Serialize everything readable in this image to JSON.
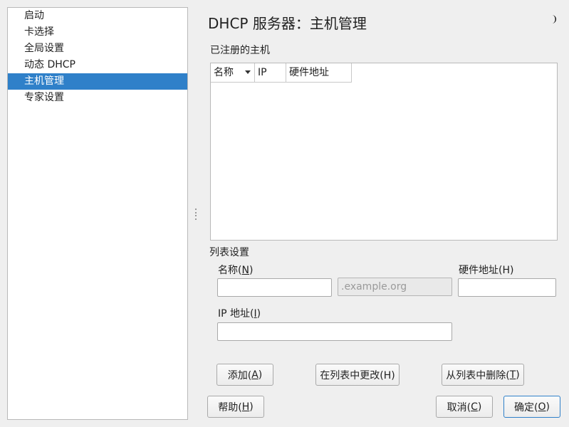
{
  "sidebar": {
    "items": [
      {
        "label": "启动"
      },
      {
        "label": "卡选择"
      },
      {
        "label": "全局设置"
      },
      {
        "label": "动态 DHCP"
      },
      {
        "label": "主机管理"
      },
      {
        "label": "专家设置"
      }
    ],
    "selected_index": 4
  },
  "header": {
    "title": "DHCP 服务器：主机管理",
    "theme_icon": "moon-icon"
  },
  "registered_hosts": {
    "label": "已注册的主机",
    "columns": [
      "名称",
      "IP",
      "硬件地址"
    ],
    "rows": []
  },
  "list_settings": {
    "label": "列表设置",
    "name_label": "名称(",
    "name_key": "N",
    "hw_label": "硬件地址(H)",
    "domain_placeholder": ".example.org",
    "ip_label": "IP 地址(",
    "ip_key": "I"
  },
  "actions": {
    "add": {
      "text": "添加(",
      "key": "A"
    },
    "change": {
      "text": "在列表中更改(H)"
    },
    "delete": {
      "text": "从列表中删除(",
      "key": "T"
    }
  },
  "footer": {
    "help": {
      "text": "帮助(",
      "key": "H"
    },
    "cancel": {
      "text": "取消(",
      "key": "C"
    },
    "ok": {
      "text": "确定(",
      "key": "O"
    }
  },
  "colors": {
    "selection": "#2f80c9",
    "background": "#efefef"
  }
}
